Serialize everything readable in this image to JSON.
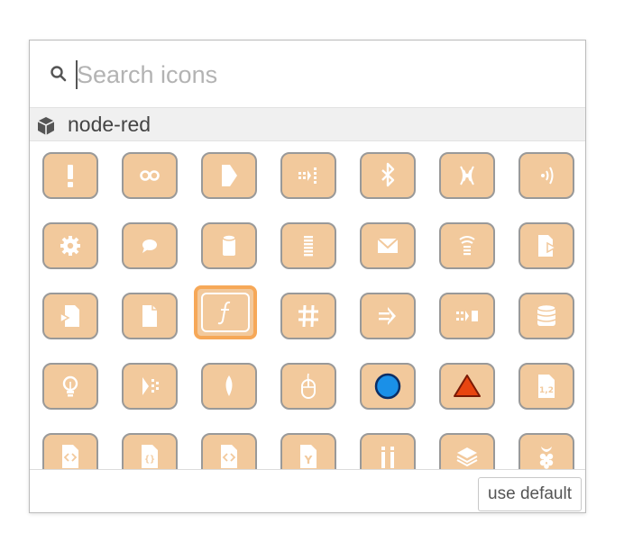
{
  "search": {
    "placeholder": "Search icons"
  },
  "group": {
    "label": "node-red"
  },
  "footer": {
    "use_default_label": "use default"
  },
  "colors": {
    "tile": "#f2c99c",
    "tile_border": "#999999",
    "selected_border": "#f6a858"
  },
  "icons": [
    "alert-icon",
    "link-icon",
    "arrow-right-icon",
    "batch-icon",
    "bluetooth-icon",
    "feed-icon",
    "broadcast-icon",
    "cog-icon",
    "comment-icon",
    "db-icon",
    "debug-icon",
    "envelope-icon",
    "wifi-icon",
    "file-out-icon",
    "file-in-icon",
    "file-icon",
    "function-icon",
    "hash-icon",
    "inject-icon",
    "join-icon",
    "database-icon",
    "light-icon",
    "split-icon",
    "leaf-icon",
    "mouse-icon",
    "blue-circle-icon",
    "red-triangle-icon",
    "csv-icon",
    "html-icon",
    "json-icon",
    "xml-icon",
    "yaml-icon",
    "info-icon",
    "layer-icon",
    "rpi-icon"
  ],
  "selected_icon": "function-icon"
}
